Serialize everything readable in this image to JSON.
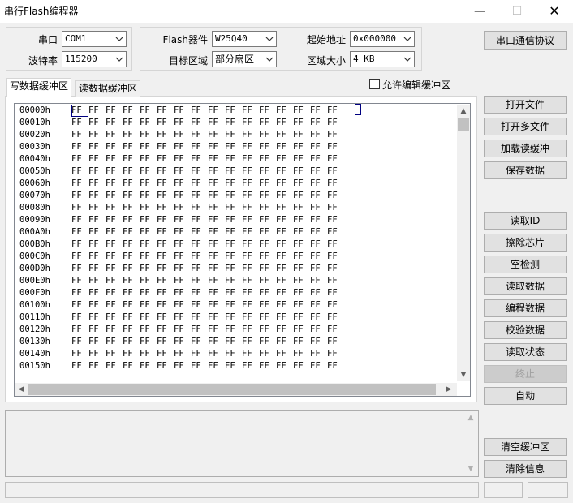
{
  "window": {
    "title": "串行Flash编程器",
    "min": "—",
    "max": "☐",
    "close": "✕"
  },
  "serial": {
    "port_label": "串口",
    "port_value": "COM1",
    "baud_label": "波特率",
    "baud_value": "115200"
  },
  "flash": {
    "device_label": "Flash器件",
    "device_value": "W25Q40",
    "region_label": "目标区域",
    "region_value": "部分扇区",
    "start_label": "起始地址",
    "start_value": "0x000000",
    "size_label": "区域大小",
    "size_value": "4 KB"
  },
  "protocol_button": "串口通信协议",
  "tabs": {
    "write": "写数据缓冲区",
    "read": "读数据缓冲区"
  },
  "allow_edit": "允许编辑缓冲区",
  "hex": {
    "rows": [
      {
        "addr": "00000h",
        "bytes": [
          "FF",
          "FF",
          "FF",
          "FF",
          "FF",
          "FF",
          "FF",
          "FF",
          "FF",
          "FF",
          "FF",
          "FF",
          "FF",
          "FF",
          "FF",
          "FF"
        ]
      },
      {
        "addr": "00010h",
        "bytes": [
          "FF",
          "FF",
          "FF",
          "FF",
          "FF",
          "FF",
          "FF",
          "FF",
          "FF",
          "FF",
          "FF",
          "FF",
          "FF",
          "FF",
          "FF",
          "FF"
        ]
      },
      {
        "addr": "00020h",
        "bytes": [
          "FF",
          "FF",
          "FF",
          "FF",
          "FF",
          "FF",
          "FF",
          "FF",
          "FF",
          "FF",
          "FF",
          "FF",
          "FF",
          "FF",
          "FF",
          "FF"
        ]
      },
      {
        "addr": "00030h",
        "bytes": [
          "FF",
          "FF",
          "FF",
          "FF",
          "FF",
          "FF",
          "FF",
          "FF",
          "FF",
          "FF",
          "FF",
          "FF",
          "FF",
          "FF",
          "FF",
          "FF"
        ]
      },
      {
        "addr": "00040h",
        "bytes": [
          "FF",
          "FF",
          "FF",
          "FF",
          "FF",
          "FF",
          "FF",
          "FF",
          "FF",
          "FF",
          "FF",
          "FF",
          "FF",
          "FF",
          "FF",
          "FF"
        ]
      },
      {
        "addr": "00050h",
        "bytes": [
          "FF",
          "FF",
          "FF",
          "FF",
          "FF",
          "FF",
          "FF",
          "FF",
          "FF",
          "FF",
          "FF",
          "FF",
          "FF",
          "FF",
          "FF",
          "FF"
        ]
      },
      {
        "addr": "00060h",
        "bytes": [
          "FF",
          "FF",
          "FF",
          "FF",
          "FF",
          "FF",
          "FF",
          "FF",
          "FF",
          "FF",
          "FF",
          "FF",
          "FF",
          "FF",
          "FF",
          "FF"
        ]
      },
      {
        "addr": "00070h",
        "bytes": [
          "FF",
          "FF",
          "FF",
          "FF",
          "FF",
          "FF",
          "FF",
          "FF",
          "FF",
          "FF",
          "FF",
          "FF",
          "FF",
          "FF",
          "FF",
          "FF"
        ]
      },
      {
        "addr": "00080h",
        "bytes": [
          "FF",
          "FF",
          "FF",
          "FF",
          "FF",
          "FF",
          "FF",
          "FF",
          "FF",
          "FF",
          "FF",
          "FF",
          "FF",
          "FF",
          "FF",
          "FF"
        ]
      },
      {
        "addr": "00090h",
        "bytes": [
          "FF",
          "FF",
          "FF",
          "FF",
          "FF",
          "FF",
          "FF",
          "FF",
          "FF",
          "FF",
          "FF",
          "FF",
          "FF",
          "FF",
          "FF",
          "FF"
        ]
      },
      {
        "addr": "000A0h",
        "bytes": [
          "FF",
          "FF",
          "FF",
          "FF",
          "FF",
          "FF",
          "FF",
          "FF",
          "FF",
          "FF",
          "FF",
          "FF",
          "FF",
          "FF",
          "FF",
          "FF"
        ]
      },
      {
        "addr": "000B0h",
        "bytes": [
          "FF",
          "FF",
          "FF",
          "FF",
          "FF",
          "FF",
          "FF",
          "FF",
          "FF",
          "FF",
          "FF",
          "FF",
          "FF",
          "FF",
          "FF",
          "FF"
        ]
      },
      {
        "addr": "000C0h",
        "bytes": [
          "FF",
          "FF",
          "FF",
          "FF",
          "FF",
          "FF",
          "FF",
          "FF",
          "FF",
          "FF",
          "FF",
          "FF",
          "FF",
          "FF",
          "FF",
          "FF"
        ]
      },
      {
        "addr": "000D0h",
        "bytes": [
          "FF",
          "FF",
          "FF",
          "FF",
          "FF",
          "FF",
          "FF",
          "FF",
          "FF",
          "FF",
          "FF",
          "FF",
          "FF",
          "FF",
          "FF",
          "FF"
        ]
      },
      {
        "addr": "000E0h",
        "bytes": [
          "FF",
          "FF",
          "FF",
          "FF",
          "FF",
          "FF",
          "FF",
          "FF",
          "FF",
          "FF",
          "FF",
          "FF",
          "FF",
          "FF",
          "FF",
          "FF"
        ]
      },
      {
        "addr": "000F0h",
        "bytes": [
          "FF",
          "FF",
          "FF",
          "FF",
          "FF",
          "FF",
          "FF",
          "FF",
          "FF",
          "FF",
          "FF",
          "FF",
          "FF",
          "FF",
          "FF",
          "FF"
        ]
      },
      {
        "addr": "00100h",
        "bytes": [
          "FF",
          "FF",
          "FF",
          "FF",
          "FF",
          "FF",
          "FF",
          "FF",
          "FF",
          "FF",
          "FF",
          "FF",
          "FF",
          "FF",
          "FF",
          "FF"
        ]
      },
      {
        "addr": "00110h",
        "bytes": [
          "FF",
          "FF",
          "FF",
          "FF",
          "FF",
          "FF",
          "FF",
          "FF",
          "FF",
          "FF",
          "FF",
          "FF",
          "FF",
          "FF",
          "FF",
          "FF"
        ]
      },
      {
        "addr": "00120h",
        "bytes": [
          "FF",
          "FF",
          "FF",
          "FF",
          "FF",
          "FF",
          "FF",
          "FF",
          "FF",
          "FF",
          "FF",
          "FF",
          "FF",
          "FF",
          "FF",
          "FF"
        ]
      },
      {
        "addr": "00130h",
        "bytes": [
          "FF",
          "FF",
          "FF",
          "FF",
          "FF",
          "FF",
          "FF",
          "FF",
          "FF",
          "FF",
          "FF",
          "FF",
          "FF",
          "FF",
          "FF",
          "FF"
        ]
      },
      {
        "addr": "00140h",
        "bytes": [
          "FF",
          "FF",
          "FF",
          "FF",
          "FF",
          "FF",
          "FF",
          "FF",
          "FF",
          "FF",
          "FF",
          "FF",
          "FF",
          "FF",
          "FF",
          "FF"
        ]
      },
      {
        "addr": "00150h",
        "bytes": [
          "FF",
          "FF",
          "FF",
          "FF",
          "FF",
          "FF",
          "FF",
          "FF",
          "FF",
          "FF",
          "FF",
          "FF",
          "FF",
          "FF",
          "FF",
          "FF"
        ]
      }
    ]
  },
  "buttons": {
    "open_file": "打开文件",
    "open_multi": "打开多文件",
    "load_read_buf": "加载读缓冲",
    "save_data": "保存数据",
    "read_id": "读取ID",
    "erase_chip": "擦除芯片",
    "blank_check": "空检测",
    "read_data": "读取数据",
    "program_data": "编程数据",
    "verify_data": "校验数据",
    "read_status": "读取状态",
    "stop": "终止",
    "auto": "自动",
    "clear_buffer": "清空缓冲区",
    "clear_info": "清除信息"
  },
  "scroll": {
    "up": "▲",
    "down": "▼",
    "left": "◀",
    "right": "▶"
  },
  "icons": [
    "chevron-down-icon",
    "checkbox-icon",
    "close-icon",
    "minimize-icon",
    "maximize-icon"
  ]
}
